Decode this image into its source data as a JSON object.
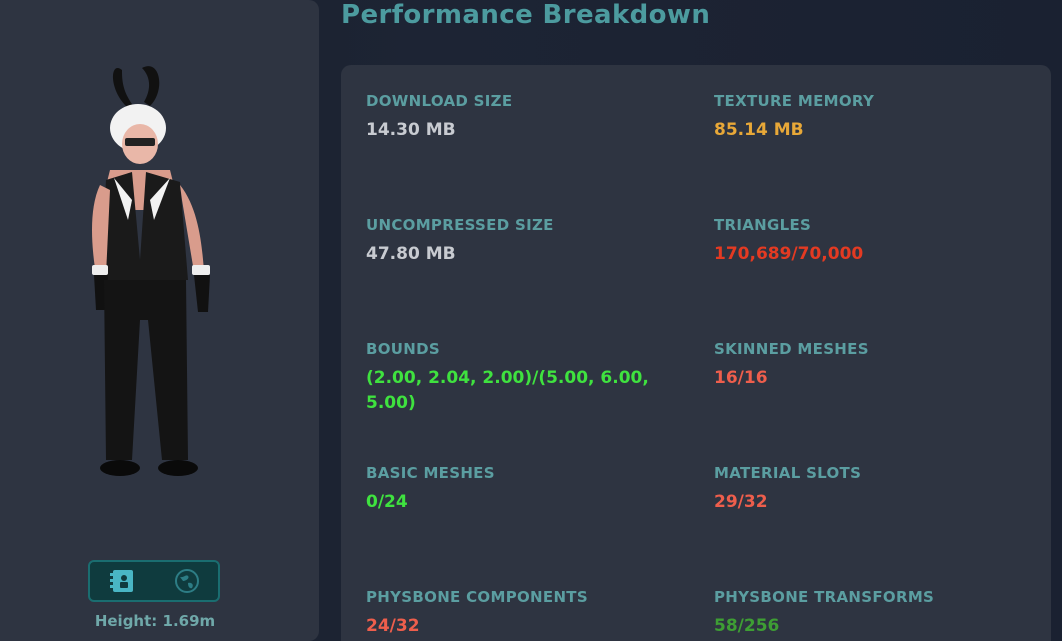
{
  "title": "Performance Breakdown",
  "avatar": {
    "height_label": "Height: 1.69m",
    "view_buttons": [
      {
        "icon": "id-card-icon"
      },
      {
        "icon": "globe-icon"
      }
    ]
  },
  "stats": [
    {
      "label": "DOWNLOAD SIZE",
      "value": "14.30 MB",
      "color": "#c8cbd1"
    },
    {
      "label": "TEXTURE MEMORY",
      "value": "85.14 MB",
      "color": "#e8a838"
    },
    {
      "label": "UNCOMPRESSED SIZE",
      "value": "47.80 MB",
      "color": "#c8cbd1"
    },
    {
      "label": "TRIANGLES",
      "value": "170,689/70,000",
      "color": "#e43a22"
    },
    {
      "label": "BOUNDS",
      "value": "(2.00, 2.04, 2.00)/(5.00, 6.00, 5.00)",
      "color": "#3fe23f"
    },
    {
      "label": "SKINNED MESHES",
      "value": "16/16",
      "color": "#ee5e4c"
    },
    {
      "label": "BASIC MESHES",
      "value": "0/24",
      "color": "#3fe23f"
    },
    {
      "label": "MATERIAL SLOTS",
      "value": "29/32",
      "color": "#ee5e4c"
    },
    {
      "label": "PHYSBONE COMPONENTS",
      "value": "24/32",
      "color": "#ee5e4c"
    },
    {
      "label": "PHYSBONE TRANSFORMS",
      "value": "58/256",
      "color": "#3e9e34"
    }
  ]
}
